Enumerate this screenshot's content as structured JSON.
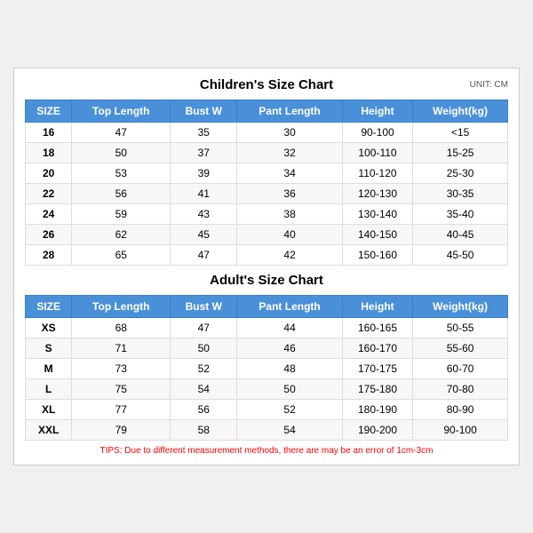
{
  "children": {
    "title": "Children's Size Chart",
    "unit": "UNIT: CM",
    "headers": [
      "SIZE",
      "Top Length",
      "Bust W",
      "Pant Length",
      "Height",
      "Weight(kg)"
    ],
    "rows": [
      [
        "16",
        "47",
        "35",
        "30",
        "90-100",
        "<15"
      ],
      [
        "18",
        "50",
        "37",
        "32",
        "100-110",
        "15-25"
      ],
      [
        "20",
        "53",
        "39",
        "34",
        "110-120",
        "25-30"
      ],
      [
        "22",
        "56",
        "41",
        "36",
        "120-130",
        "30-35"
      ],
      [
        "24",
        "59",
        "43",
        "38",
        "130-140",
        "35-40"
      ],
      [
        "26",
        "62",
        "45",
        "40",
        "140-150",
        "40-45"
      ],
      [
        "28",
        "65",
        "47",
        "42",
        "150-160",
        "45-50"
      ]
    ]
  },
  "adults": {
    "title": "Adult's Size Chart",
    "headers": [
      "SIZE",
      "Top Length",
      "Bust W",
      "Pant Length",
      "Height",
      "Weight(kg)"
    ],
    "rows": [
      [
        "XS",
        "68",
        "47",
        "44",
        "160-165",
        "50-55"
      ],
      [
        "S",
        "71",
        "50",
        "46",
        "160-170",
        "55-60"
      ],
      [
        "M",
        "73",
        "52",
        "48",
        "170-175",
        "60-70"
      ],
      [
        "L",
        "75",
        "54",
        "50",
        "175-180",
        "70-80"
      ],
      [
        "XL",
        "77",
        "56",
        "52",
        "180-190",
        "80-90"
      ],
      [
        "XXL",
        "79",
        "58",
        "54",
        "190-200",
        "90-100"
      ]
    ]
  },
  "tips": "TIPS: Due to different measurement methods, there are may be an error of 1cm-3cm"
}
